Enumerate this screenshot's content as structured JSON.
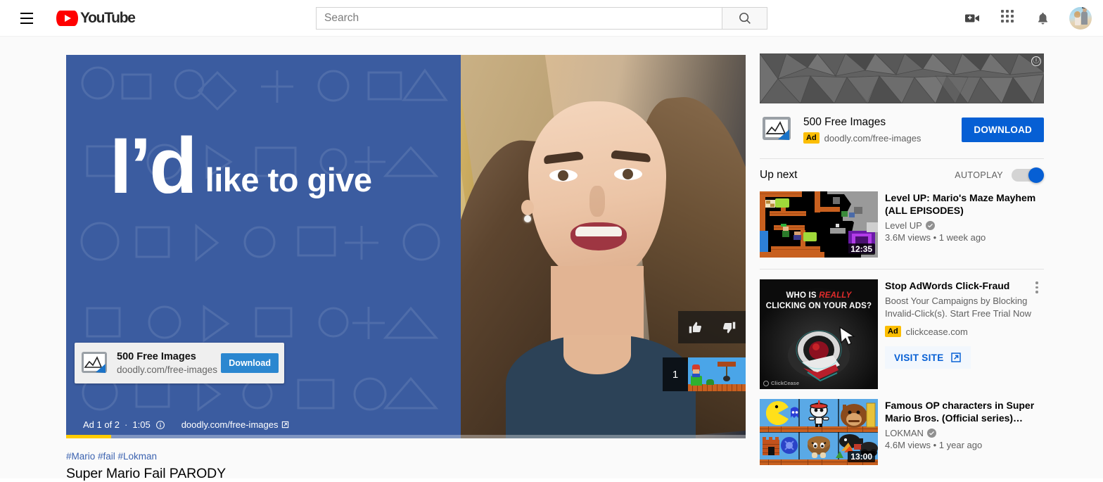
{
  "masthead": {
    "menu_icon": "hamburger-icon",
    "logo_text": "YouTube",
    "search": {
      "placeholder": "Search",
      "value": "",
      "button_icon": "search-icon"
    },
    "actions": [
      {
        "name": "create-video-icon",
        "label": "Create"
      },
      {
        "name": "apps-grid-icon",
        "label": "YouTube apps"
      },
      {
        "name": "notifications-bell-icon",
        "label": "Notifications"
      },
      {
        "name": "avatar",
        "label": "Account"
      }
    ]
  },
  "player": {
    "ad_creative": {
      "headline_big": "I’d",
      "headline_small": "like to give",
      "background_color": "#3b5ca0"
    },
    "ad_overlay_card": {
      "title": "500 Free Images",
      "url": "doodly.com/free-images",
      "button_label": "Download",
      "button_color": "#2b87d0"
    },
    "like_button": "thumbs-up-icon",
    "dislike_button": "thumbs-down-icon",
    "next_video_counter": "1",
    "ad_status": {
      "counter": "Ad 1 of 2",
      "separator": "·",
      "time_remaining": "1:05",
      "info_icon": "info-icon",
      "visit_url": "doodly.com/free-images",
      "external_icon": "external-link-icon"
    },
    "progress_percent": 6.6,
    "progress_color": "#ffcc00"
  },
  "video_meta": {
    "hashtags": "#Mario #fail #Lokman",
    "title": "Super Mario Fail PARODY"
  },
  "sidebar": {
    "banner_ad": {
      "info_icon": "ⓘ",
      "card": {
        "title": "500 Free Images",
        "ad_badge": "Ad",
        "url": "doodly.com/free-images",
        "button_label": "DOWNLOAD",
        "button_color": "#065fd4"
      }
    },
    "upnext": {
      "label": "Up next",
      "autoplay_label": "AUTOPLAY",
      "autoplay_on": true,
      "toggle_color": "#065fd4"
    },
    "items": [
      {
        "type": "video",
        "title": "Level UP: Mario's Maze Mayhem (ALL EPISODES)",
        "channel": "Level UP",
        "verified": true,
        "stats": "3.6M views • 1 week ago",
        "duration": "12:35"
      },
      {
        "type": "ad",
        "title": "Stop AdWords Click-Fraud",
        "description": "Boost Your Campaigns by Blocking Invalid-Click(s). Start Free Trial Now",
        "ad_badge": "Ad",
        "url": "clickcease.com",
        "button_label": "VISIT SITE",
        "button_icon": "external-link-icon",
        "menu_icon": "kebab-menu-icon",
        "thumb_text_line1": "WHO IS ",
        "thumb_text_highlight": "REALLY",
        "thumb_text_line2": "CLICKING ON YOUR ADS?",
        "thumb_brand": "ClickCease",
        "highlight_color": "#e02b2b"
      },
      {
        "type": "video",
        "title": "Famous OP characters in Super Mario Bros. (Official series)…",
        "channel": "LOKMAN",
        "verified": true,
        "stats": "4.6M views • 1 year ago",
        "duration": "13:00"
      }
    ]
  }
}
